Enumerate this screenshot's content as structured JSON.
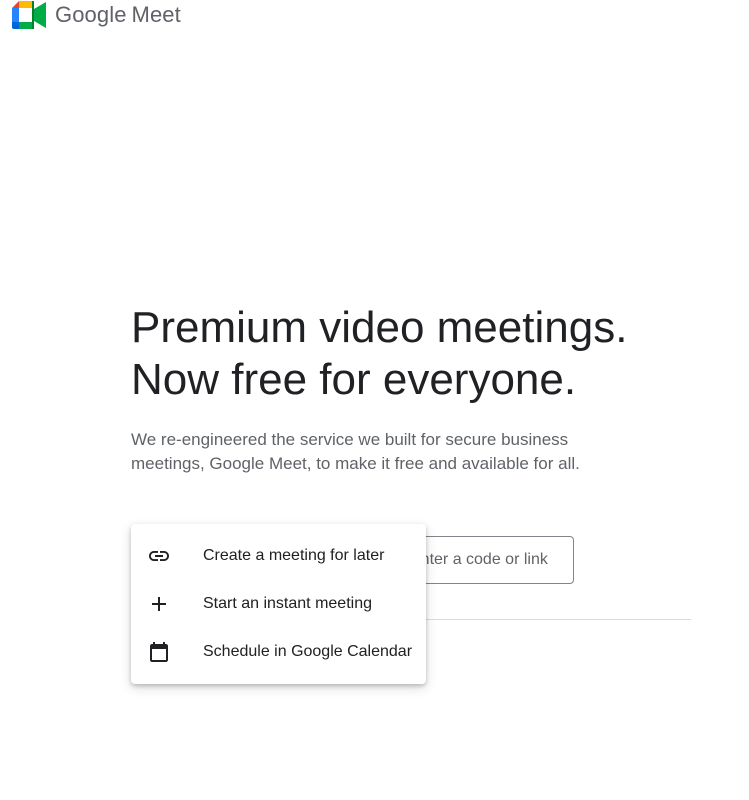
{
  "header": {
    "brand_word": "Google",
    "product_word": "Meet",
    "logo_icon": "google-meet-logo"
  },
  "hero": {
    "headline_line1": "Premium video meetings.",
    "headline_line2": "Now free for everyone.",
    "subtext": "We re-engineered the service we built for secure business meetings, Google Meet, to make it free and available for all."
  },
  "join": {
    "placeholder": "Enter a code or link"
  },
  "new_meeting_menu": {
    "items": [
      {
        "label": "Create a meeting for later",
        "icon": "link-icon"
      },
      {
        "label": "Start an instant meeting",
        "icon": "plus-icon"
      },
      {
        "label": "Schedule in Google Calendar",
        "icon": "calendar-icon"
      }
    ]
  },
  "colors": {
    "headline": "#202124",
    "subtext": "#5f6368",
    "logo_green": "#00832d",
    "logo_blue": "#0066da",
    "logo_red": "#e94235",
    "logo_yellow": "#ffba00",
    "logo_lightgreen": "#00ac47",
    "logo_lightblue": "#2684fc"
  }
}
